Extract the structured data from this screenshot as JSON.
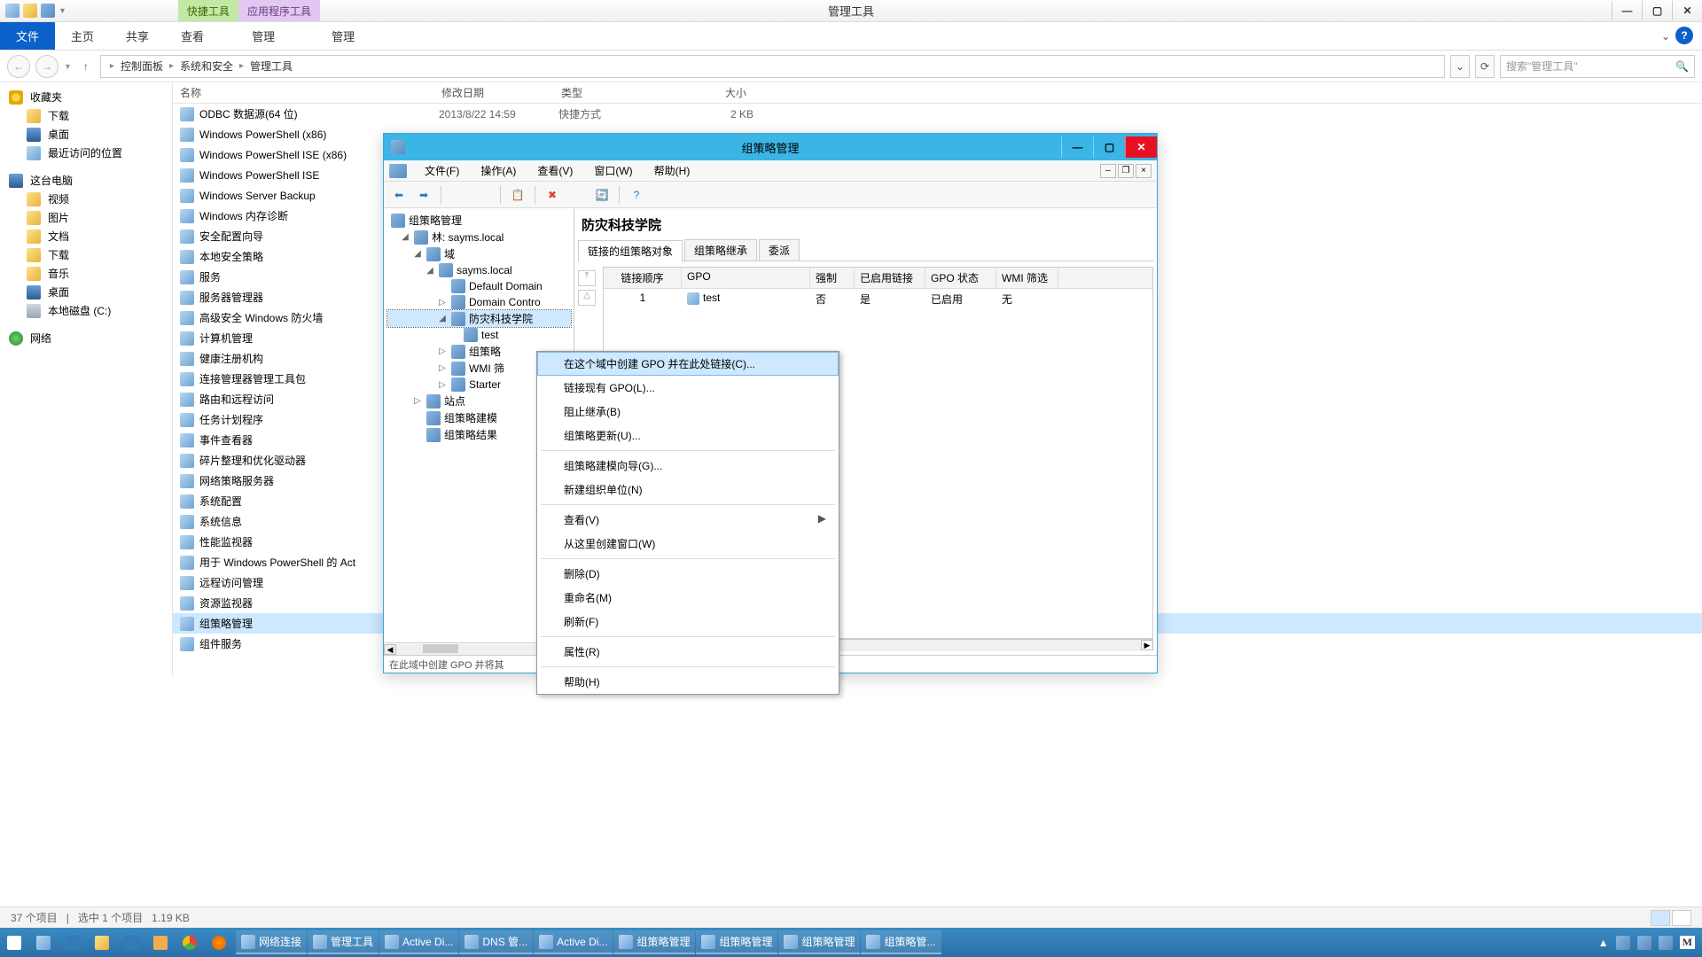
{
  "titlebar": {
    "context_tabs": [
      {
        "label": "快捷工具",
        "class": "green"
      },
      {
        "label": "应用程序工具",
        "class": "purple"
      }
    ],
    "title": "管理工具"
  },
  "ribbon": {
    "file": "文件",
    "tabs": [
      "主页",
      "共享",
      "查看",
      "管理",
      "管理"
    ]
  },
  "address": {
    "segments": [
      "控制面板",
      "系统和安全",
      "管理工具"
    ],
    "search_placeholder": "搜索\"管理工具\""
  },
  "sidebar": {
    "fav_header": "收藏夹",
    "fav_items": [
      "下载",
      "桌面",
      "最近访问的位置"
    ],
    "pc_header": "这台电脑",
    "pc_items": [
      "视频",
      "图片",
      "文档",
      "下载",
      "音乐",
      "桌面",
      "本地磁盘 (C:)"
    ],
    "net_header": "网络"
  },
  "columns": {
    "name": "名称",
    "date": "修改日期",
    "type": "类型",
    "size": "大小"
  },
  "files": [
    {
      "name": "ODBC 数据源(64 位)",
      "date": "2013/8/22 14:59",
      "type": "快捷方式",
      "size": "2 KB"
    },
    {
      "name": "Windows PowerShell (x86)",
      "date": "",
      "type": "",
      "size": ""
    },
    {
      "name": "Windows PowerShell ISE (x86)",
      "date": "",
      "type": "",
      "size": ""
    },
    {
      "name": "Windows PowerShell ISE",
      "date": "",
      "type": "",
      "size": ""
    },
    {
      "name": "Windows Server Backup",
      "date": "",
      "type": "",
      "size": ""
    },
    {
      "name": "Windows 内存诊断",
      "date": "",
      "type": "",
      "size": ""
    },
    {
      "name": "安全配置向导",
      "date": "",
      "type": "",
      "size": ""
    },
    {
      "name": "本地安全策略",
      "date": "",
      "type": "",
      "size": ""
    },
    {
      "name": "服务",
      "date": "",
      "type": "",
      "size": ""
    },
    {
      "name": "服务器管理器",
      "date": "",
      "type": "",
      "size": ""
    },
    {
      "name": "高级安全 Windows 防火墙",
      "date": "",
      "type": "",
      "size": ""
    },
    {
      "name": "计算机管理",
      "date": "",
      "type": "",
      "size": ""
    },
    {
      "name": "健康注册机构",
      "date": "",
      "type": "",
      "size": ""
    },
    {
      "name": "连接管理器管理工具包",
      "date": "",
      "type": "",
      "size": ""
    },
    {
      "name": "路由和远程访问",
      "date": "",
      "type": "",
      "size": ""
    },
    {
      "name": "任务计划程序",
      "date": "",
      "type": "",
      "size": ""
    },
    {
      "name": "事件查看器",
      "date": "",
      "type": "",
      "size": ""
    },
    {
      "name": "碎片整理和优化驱动器",
      "date": "",
      "type": "",
      "size": ""
    },
    {
      "name": "网络策略服务器",
      "date": "",
      "type": "",
      "size": ""
    },
    {
      "name": "系统配置",
      "date": "",
      "type": "",
      "size": ""
    },
    {
      "name": "系统信息",
      "date": "",
      "type": "",
      "size": ""
    },
    {
      "name": "性能监视器",
      "date": "",
      "type": "",
      "size": ""
    },
    {
      "name": "用于 Windows PowerShell 的 Act",
      "date": "",
      "type": "",
      "size": ""
    },
    {
      "name": "远程访问管理",
      "date": "",
      "type": "",
      "size": ""
    },
    {
      "name": "资源监视器",
      "date": "",
      "type": "",
      "size": ""
    },
    {
      "name": "组策略管理",
      "date": "",
      "type": "",
      "size": "",
      "selected": true
    },
    {
      "name": "组件服务",
      "date": "",
      "type": "",
      "size": ""
    }
  ],
  "statusbar": {
    "count": "37 个项目",
    "selected": "选中 1 个项目",
    "size": "1.19 KB"
  },
  "gpmc": {
    "title": "组策略管理",
    "menu": [
      "文件(F)",
      "操作(A)",
      "查看(V)",
      "窗口(W)",
      "帮助(H)"
    ],
    "tree": {
      "root": "组策略管理",
      "forest": "林: sayms.local",
      "domains": "域",
      "domain": "sayms.local",
      "ddp": "Default Domain",
      "dc_ou": "Domain Contro",
      "ou": "防灾科技学院",
      "gpo_link": "test",
      "gpo_container": "组策略",
      "wmi": "WMI 筛",
      "starter": "Starter",
      "sites": "站点",
      "model": "组策略建模",
      "results": "组策略结果"
    },
    "right": {
      "title": "防灾科技学院",
      "tabs": [
        "链接的组策略对象",
        "组策略继承",
        "委派"
      ],
      "table_headers": {
        "order": "链接顺序",
        "gpo": "GPO",
        "force": "强制",
        "enabled": "已启用链接",
        "status": "GPO 状态",
        "wmi": "WMI 筛选"
      },
      "rows": [
        {
          "order": "1",
          "gpo": "test",
          "force": "否",
          "enabled": "是",
          "status": "已启用",
          "wmi": "无"
        }
      ]
    },
    "status": "在此域中创建 GPO 并将其"
  },
  "context_menu": [
    {
      "label": "在这个域中创建 GPO 并在此处链接(C)...",
      "hilite": true
    },
    {
      "label": "链接现有 GPO(L)..."
    },
    {
      "label": "阻止继承(B)"
    },
    {
      "label": "组策略更新(U)..."
    },
    {
      "sep": true
    },
    {
      "label": "组策略建模向导(G)..."
    },
    {
      "label": "新建组织单位(N)"
    },
    {
      "sep": true
    },
    {
      "label": "查看(V)",
      "submenu": true
    },
    {
      "label": "从这里创建窗口(W)"
    },
    {
      "sep": true
    },
    {
      "label": "删除(D)"
    },
    {
      "label": "重命名(M)"
    },
    {
      "label": "刷新(F)"
    },
    {
      "sep": true
    },
    {
      "label": "属性(R)"
    },
    {
      "sep": true
    },
    {
      "label": "帮助(H)"
    }
  ],
  "taskbar": {
    "apps": [
      "网络连接",
      "管理工具",
      "Active Di...",
      "DNS 管...",
      "Active Di...",
      "组策略管理",
      "组策略管理",
      "组策略管理",
      "组策略管..."
    ]
  }
}
